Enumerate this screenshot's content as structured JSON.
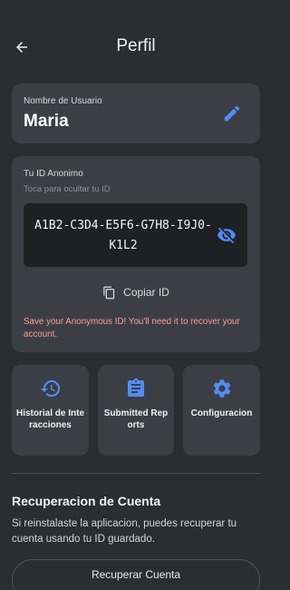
{
  "header": {
    "title": "Perfil",
    "back_icon": "arrow-left-icon"
  },
  "username": {
    "label": "Nombre de Usuario",
    "value": "Maria",
    "edit_icon": "pencil-icon"
  },
  "anonymous_id": {
    "title": "Tu ID Anonimo",
    "hint": "Toca para ocultar tu ID",
    "value": "A1B2-C3D4-E5F6-G7H8-I9J0-K1L2",
    "visibility_icon": "eye-off-icon",
    "copy_label": "Copiar ID",
    "copy_icon": "copy-icon",
    "warning": "Save your Anonymous ID! You'll need it to recover your account."
  },
  "actions": [
    {
      "label": "Historial de Interacciones",
      "icon": "history-icon"
    },
    {
      "label": "Submitted Reports",
      "icon": "clipboard-icon"
    },
    {
      "label": "Configuracion",
      "icon": "gear-icon"
    }
  ],
  "recovery": {
    "title": "Recuperacion de Cuenta",
    "description": "Si reinstalaste la aplicacion, puedes recuperar tu cuenta usando tu ID guardado.",
    "button_label": "Recuperar Cuenta"
  },
  "colors": {
    "background": "#2a2d32",
    "card": "#3b3f45",
    "accent": "#4f8ef7",
    "warning": "#ff9a95"
  }
}
